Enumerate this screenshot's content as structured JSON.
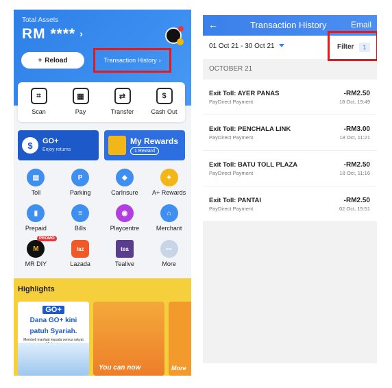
{
  "left": {
    "total_assets_label": "Total Assets",
    "balance": "RM ****",
    "balance_chevron": "›",
    "reload_label": "Reload",
    "reload_icon": "+",
    "transaction_history_link": "Transaction History",
    "transaction_history_chevron": "›",
    "quick_actions": [
      {
        "label": "Scan",
        "icon": "scan-icon",
        "glyph": "⌗"
      },
      {
        "label": "Pay",
        "icon": "qr-icon",
        "glyph": "▦"
      },
      {
        "label": "Transfer",
        "icon": "transfer-icon",
        "glyph": "⇄"
      },
      {
        "label": "Cash Out",
        "icon": "cash-out-icon",
        "glyph": "$"
      }
    ],
    "go_plus": {
      "title": "GO+",
      "subtitle": "Enjoy returns",
      "icon_glyph": "$"
    },
    "my_rewards": {
      "title": "My Rewards",
      "count": "1 Reward"
    },
    "services_row1": [
      {
        "label": "Toll",
        "color": "#3f8ff0",
        "glyph": "▤"
      },
      {
        "label": "Parking",
        "color": "#3f8ff0",
        "glyph": "P"
      },
      {
        "label": "CarInsure",
        "color": "#3f8ff0",
        "glyph": "◆"
      },
      {
        "label": "A+ Rewards",
        "color": "#f3b619",
        "glyph": "✦"
      }
    ],
    "services_row2": [
      {
        "label": "Prepaid",
        "color": "#3f8ff0",
        "glyph": "▮"
      },
      {
        "label": "Bills",
        "color": "#3f8ff0",
        "glyph": "≡"
      },
      {
        "label": "Playcentre",
        "color": "#b13ee0",
        "glyph": "◉"
      },
      {
        "label": "Merchant",
        "color": "#3f8ff0",
        "glyph": "⌂"
      }
    ],
    "services_row3": [
      {
        "label": "MR DIY",
        "color": "#111111",
        "glyph": "M",
        "tag": "PROMO"
      },
      {
        "label": "Lazada",
        "color": "#f05a28",
        "glyph": "laz"
      },
      {
        "label": "Tealive",
        "color": "#5a3d8c",
        "glyph": "tea"
      },
      {
        "label": "More",
        "color": "#c9d4e6",
        "glyph": "•••"
      }
    ],
    "highlights_title": "Highlights",
    "card1": {
      "logo": "GO+",
      "title_line1": "Dana GO+ kini",
      "title_line2": "patuh Syariah.",
      "sub": "Membeli manfaat kepada semua rakyat Malaysia."
    },
    "card2": {
      "text": "You can now"
    },
    "card3": {
      "text": "More"
    }
  },
  "right": {
    "title": "Transaction History",
    "back": "←",
    "email": "Email",
    "date_range": "01 Oct 21 - 30 Oct 21",
    "filter_label": "Filter",
    "filter_count": "1",
    "month_header": "OCTOBER 21",
    "transactions": [
      {
        "name": "Exit Toll: AYER PANAS",
        "sub": "PayDirect Payment",
        "amount": "-RM2.50",
        "time": "18 Oct, 19:49"
      },
      {
        "name": "Exit Toll: PENCHALA LINK",
        "sub": "PayDirect Payment",
        "amount": "-RM3.00",
        "time": "18 Oct, 11:21"
      },
      {
        "name": "Exit Toll: BATU TOLL PLAZA",
        "sub": "PayDirect Payment",
        "amount": "-RM2.50",
        "time": "18 Oct, 11:16"
      },
      {
        "name": "Exit Toll: PANTAI",
        "sub": "PayDirect Payment",
        "amount": "-RM2.50",
        "time": "02 Oct, 15:51"
      }
    ]
  }
}
